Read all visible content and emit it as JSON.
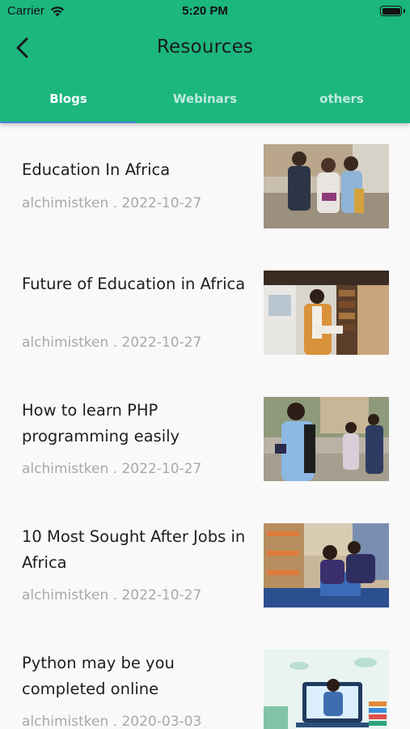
{
  "status_bar": {
    "carrier": "Carrier",
    "time": "5:20 PM"
  },
  "header": {
    "title": "Resources"
  },
  "tabs": [
    {
      "label": "Blogs",
      "active": true
    },
    {
      "label": "Webinars",
      "active": false
    },
    {
      "label": "others",
      "active": false
    }
  ],
  "colors": {
    "header_bg": "#1cb67f",
    "tab_indicator": "#4a7fe0",
    "meta_text": "#a8a8a8"
  },
  "posts": [
    {
      "title": "Education In Africa",
      "meta": "alchimistken . 2022-10-27",
      "thumbnail": "students-group-photo"
    },
    {
      "title": "Future of Education in Africa",
      "meta": "alchimistken . 2022-10-27",
      "thumbnail": "student-library-photo"
    },
    {
      "title": "How to learn PHP programming easily",
      "meta": "alchimistken . 2022-10-27",
      "thumbnail": "campus-students-photo"
    },
    {
      "title": "10 Most Sought After Jobs in Africa",
      "meta": "alchimistken . 2022-10-27",
      "thumbnail": "warehouse-workers-photo"
    },
    {
      "title": "Python may be you completed online",
      "meta": "alchimistken . 2020-03-03",
      "thumbnail": "online-learning-illustration"
    }
  ]
}
